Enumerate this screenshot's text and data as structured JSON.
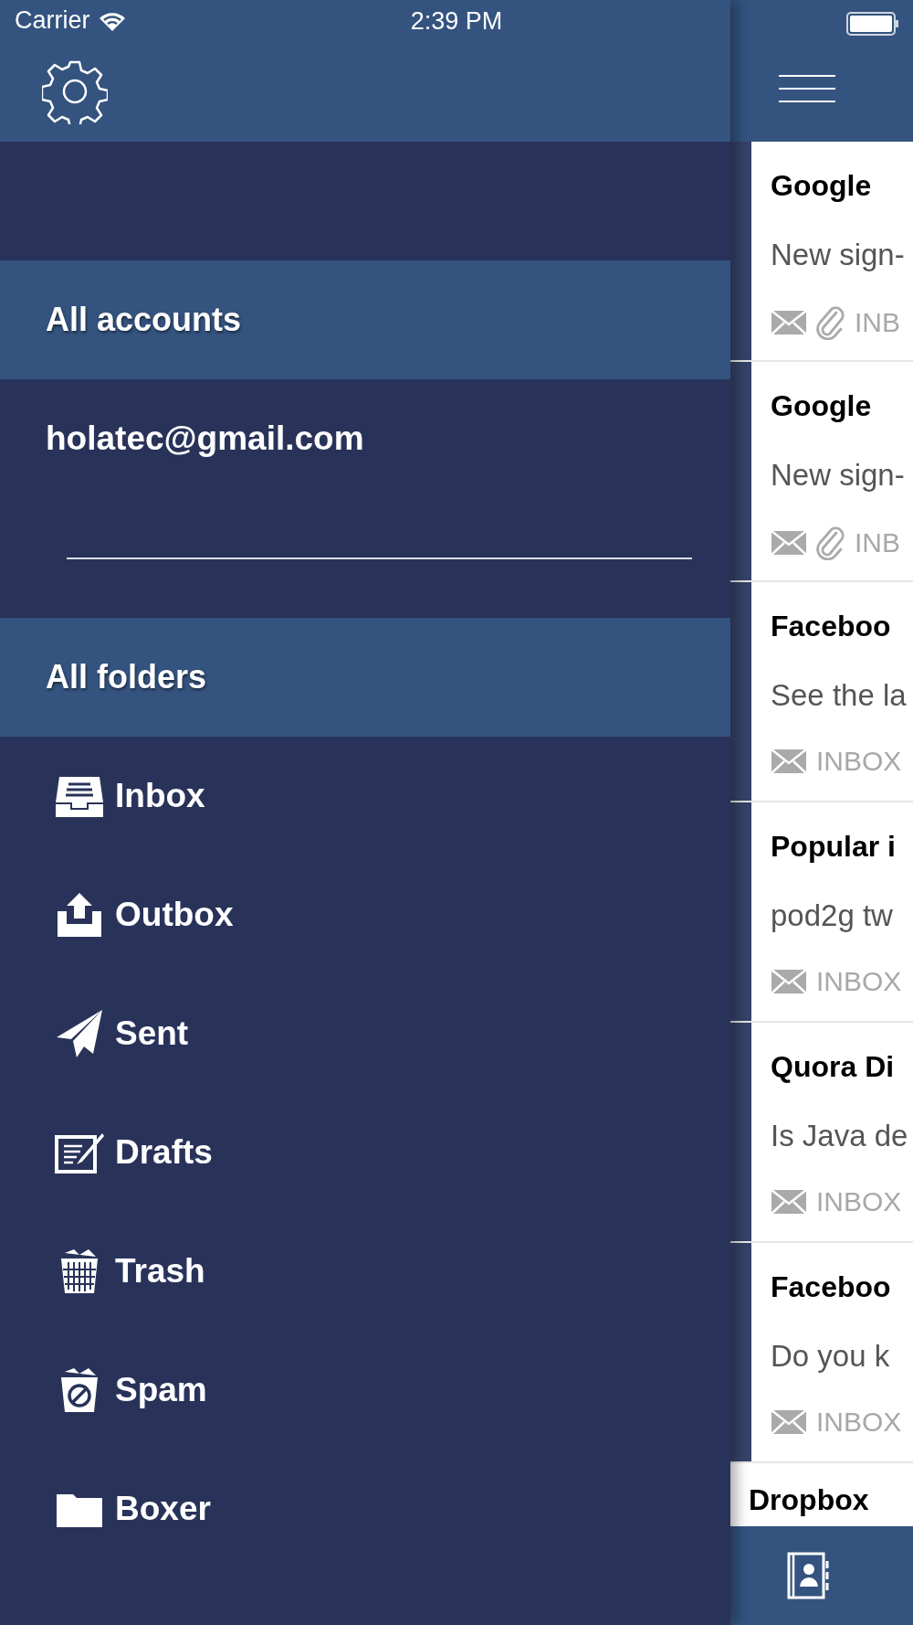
{
  "status_bar": {
    "carrier": "Carrier",
    "time": "2:39 PM"
  },
  "sidebar": {
    "accounts_header": "All accounts",
    "account": "holatec@gmail.com",
    "folders_header": "All folders",
    "folders": [
      {
        "label": "Inbox"
      },
      {
        "label": "Outbox"
      },
      {
        "label": "Sent"
      },
      {
        "label": "Drafts"
      },
      {
        "label": "Trash"
      },
      {
        "label": "Spam"
      },
      {
        "label": "Boxer"
      }
    ]
  },
  "messages": [
    {
      "kind": "marked",
      "sender": "Google",
      "preview": "New sign-",
      "attachment": true,
      "folder": "INB"
    },
    {
      "kind": "marked",
      "sender": "Google",
      "preview": "New sign-",
      "attachment": true,
      "folder": "INB"
    },
    {
      "kind": "marked",
      "sender": "Faceboo",
      "preview": "See the la",
      "attachment": false,
      "folder": "INBOX"
    },
    {
      "kind": "marked",
      "sender": "Popular i",
      "preview": "pod2g tw",
      "attachment": false,
      "folder": "INBOX"
    },
    {
      "kind": "marked",
      "sender": "Quora Di",
      "preview": "Is Java de",
      "attachment": false,
      "folder": "INBOX"
    },
    {
      "kind": "marked",
      "sender": "Faceboo",
      "preview": "Do you k",
      "attachment": false,
      "folder": "INBOX"
    },
    {
      "kind": "plain",
      "sender": "Dropbox"
    }
  ]
}
